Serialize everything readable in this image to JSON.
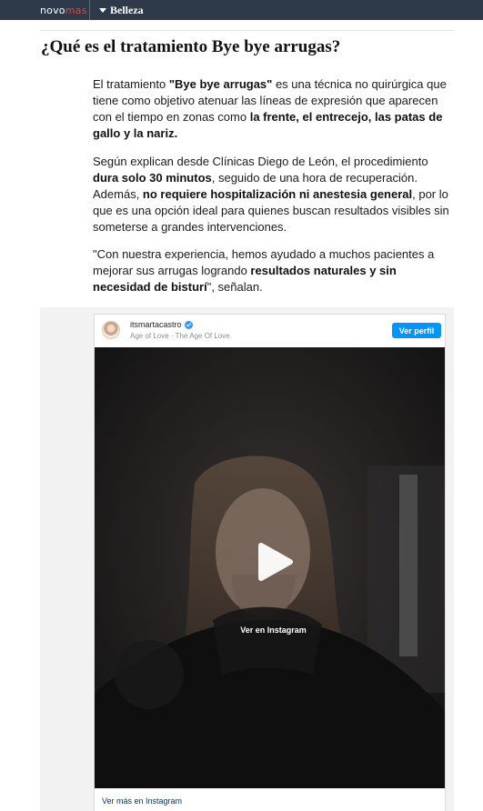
{
  "header": {
    "logo_part1": "novo",
    "logo_part2": "mas",
    "section_label": "Belleza"
  },
  "article": {
    "title": "¿Qué es el tratamiento Bye bye arrugas?",
    "p1": {
      "t1": "El tratamiento ",
      "b1": "\"Bye bye arrugas\"",
      "t2": " es una técnica no quirúrgica que tiene como objetivo atenuar las líneas de expresión que aparecen con el tiempo en zonas como ",
      "b2": "la frente, el entrecejo, las patas de gallo y la nariz."
    },
    "p2": {
      "t1": "Según explican desde Clínicas Diego de León, el procedimiento ",
      "b1": "dura solo 30 minutos",
      "t2": ", seguido de una hora de recuperación. Además, ",
      "b2": "no requiere hospitalización ni anestesia general",
      "t3": ", por lo que es una opción ideal para quienes buscan resultados visibles sin someterse a grandes intervenciones."
    },
    "p3": {
      "t1": "\"Con nuestra experiencia, hemos ayudado a muchos pacientes a mejorar sus arrugas logrando ",
      "b1": "resultados naturales y sin necesidad de bisturí",
      "t2": "\", señalan."
    }
  },
  "instagram": {
    "username": "itsmartacastro",
    "subline": "Age of Love · The Age Of Love",
    "view_profile": "Ver perfil",
    "view_on_instagram": "Ver en Instagram",
    "see_more": "Ver más en Instagram",
    "verified_color": "#3897f0",
    "button_color": "#0095f6",
    "icons": [
      "verified-icon",
      "play-icon"
    ]
  }
}
